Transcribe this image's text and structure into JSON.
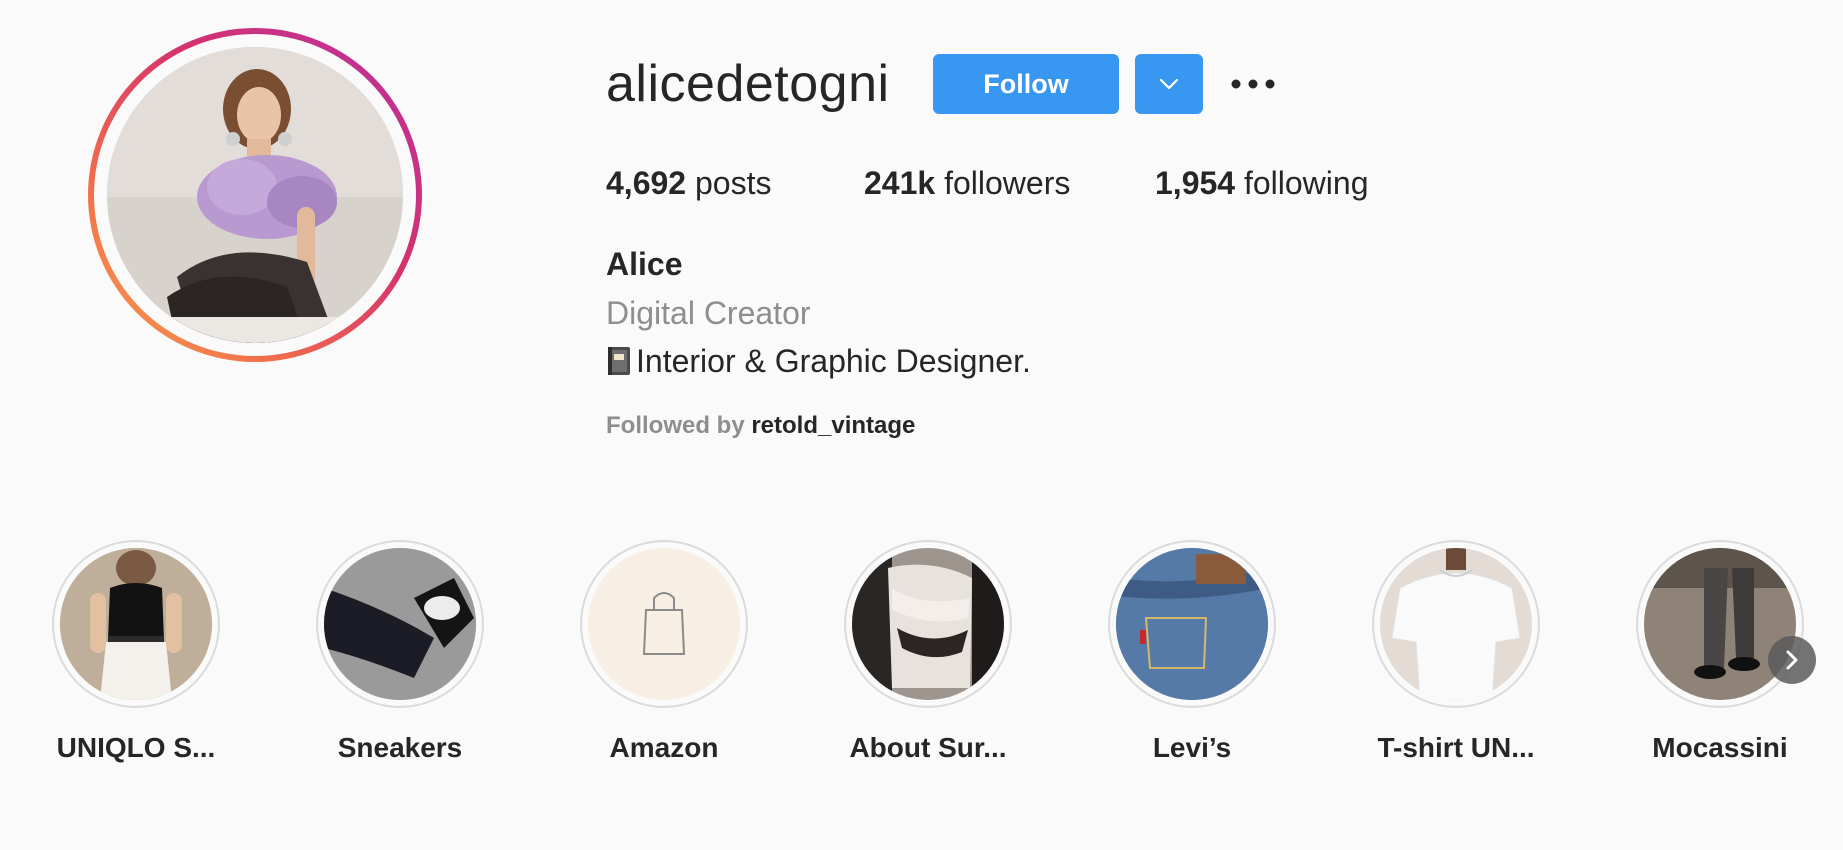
{
  "profile": {
    "username": "alicedetogni",
    "follow_label": "Follow",
    "full_name": "Alice",
    "category": "Digital Creator",
    "bio": "Interior & Graphic Designer.",
    "followed_by_prefix": "Followed by",
    "followed_by_user": "retold_vintage"
  },
  "stats": {
    "posts_count": "4,692",
    "posts_label": "posts",
    "followers_count": "241k",
    "followers_label": "followers",
    "following_count": "1,954",
    "following_label": "following"
  },
  "highlights": [
    {
      "label": "UNIQLO S..."
    },
    {
      "label": "Sneakers"
    },
    {
      "label": "Amazon"
    },
    {
      "label": "About Sur..."
    },
    {
      "label": "Levi’s"
    },
    {
      "label": "T-shirt UN..."
    },
    {
      "label": "Mocassini"
    }
  ],
  "colors": {
    "accent": "#3897f0",
    "text": "#262626",
    "muted": "#8e8e8e",
    "background": "#fafafa"
  },
  "icons": [
    "chevron-down-icon",
    "more-options-icon",
    "notebook-emoji-icon",
    "shopping-bag-icon",
    "chevron-right-icon"
  ]
}
